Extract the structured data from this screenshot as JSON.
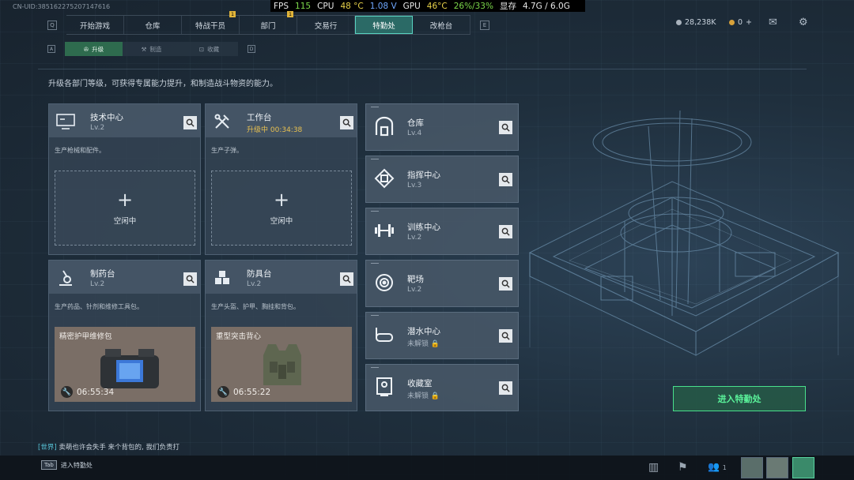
{
  "uid": "CN-UID:385162275207147616",
  "perf": {
    "fps_label": "FPS",
    "fps": "115",
    "cpu_label": "CPU",
    "cpu_temp": "48 °C",
    "voltage": "1.08 V",
    "gpu_label": "GPU",
    "gpu_temp": "46°C",
    "gpu_usage": "26%/33%",
    "mem_label": "显存",
    "mem": "4.7G / 6.0G"
  },
  "topnav": {
    "left_key": "Q",
    "right_key": "E",
    "tabs": [
      {
        "label": "开始游戏",
        "notif": ""
      },
      {
        "label": "仓库",
        "notif": ""
      },
      {
        "label": "特战干员",
        "notif": "1"
      },
      {
        "label": "部门",
        "notif": "1"
      },
      {
        "label": "交易行",
        "notif": ""
      },
      {
        "label": "特勤处",
        "notif": ""
      },
      {
        "label": "改枪台",
        "notif": ""
      }
    ]
  },
  "currency": {
    "silver": "28,238K",
    "gold": "0",
    "gold_plus": "+"
  },
  "subnav": {
    "left_key": "A",
    "right_key": "D",
    "tabs": [
      {
        "label": "升级"
      },
      {
        "label": "制造"
      },
      {
        "label": "收藏"
      }
    ]
  },
  "description": "升级各部门等级，可获得专属能力提升，和制造战斗物资的能力。",
  "cards": [
    {
      "title": "技术中心",
      "level": "Lv.2",
      "desc": "生产枪械和配件。",
      "slot_status": "空闲中"
    },
    {
      "title": "工作台",
      "level": "升级中 00:34:38",
      "desc": "生产子弹。",
      "slot_status": "空闲中"
    },
    {
      "title": "制药台",
      "level": "Lv.2",
      "desc": "生产药品、针剂和维修工具包。",
      "item_name": "精密护甲维修包",
      "timer": "06:55:34"
    },
    {
      "title": "防具台",
      "level": "Lv.2",
      "desc": "生产头盔、护甲、胸挂和背包。",
      "item_name": "重型突击背心",
      "timer": "06:55:22"
    }
  ],
  "facilities": [
    {
      "title": "仓库",
      "level": "Lv.4"
    },
    {
      "title": "指挥中心",
      "level": "Lv.3"
    },
    {
      "title": "训练中心",
      "level": "Lv.2"
    },
    {
      "title": "靶场",
      "level": "Lv.2"
    },
    {
      "title": "潜水中心",
      "level": "未解锁"
    },
    {
      "title": "收藏室",
      "level": "未解锁"
    }
  ],
  "enter_button": "进入特勤处",
  "chat": {
    "channel": "[世界]",
    "message": "卖萌也许会失手 来个背包的, 我们负责打"
  },
  "bottom": {
    "key": "Tab",
    "label": "进入特勤处",
    "team_count": "1"
  },
  "colors": {
    "accent": "#58d2c0",
    "enter_green": "#49e08c",
    "timer_amber": "#e8c050"
  }
}
